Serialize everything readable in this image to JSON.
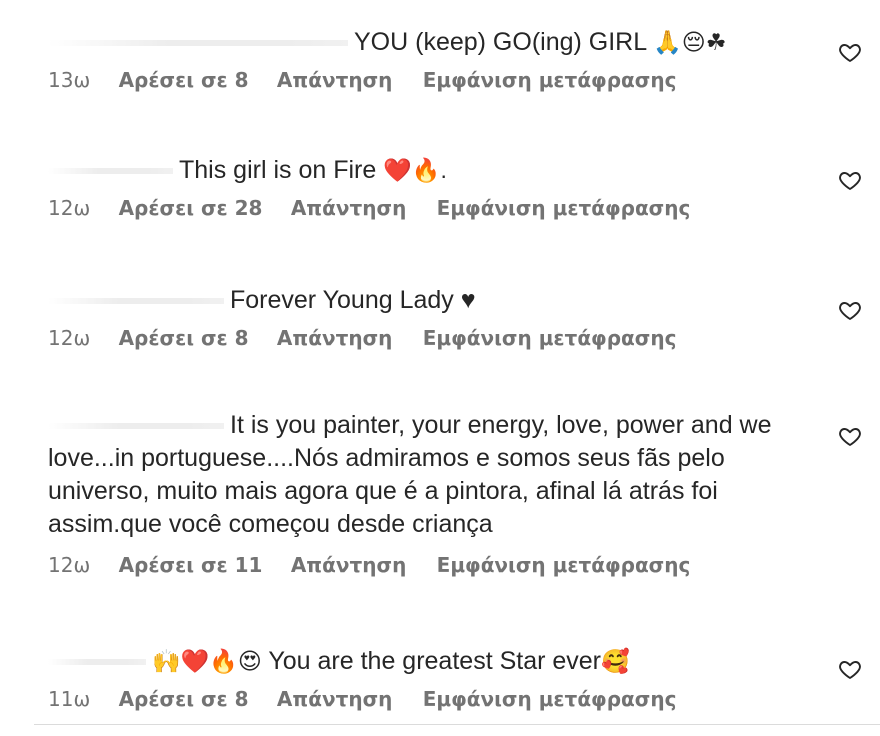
{
  "comments": [
    {
      "text": "YOU (keep) GO(ing) GIRL",
      "emojis": "🙏😔☘",
      "time": "13ω",
      "likes": "Αρέσει σε 8",
      "reply": "Απάντηση",
      "translate": "Εμφάνιση μετάφρασης"
    },
    {
      "text": "This girl is on Fire",
      "emojis": "❤️🔥.",
      "time": "12ω",
      "likes": "Αρέσει σε 28",
      "reply": "Απάντηση",
      "translate": "Εμφάνιση μετάφρασης"
    },
    {
      "text": "Forever Young Lady ♥",
      "emojis": "",
      "time": "12ω",
      "likes": "Αρέσει σε 8",
      "reply": "Απάντηση",
      "translate": "Εμφάνιση μετάφρασης"
    },
    {
      "text": "It is you painter, your energy, love, power and we love...in portuguese....Nós admiramos e somos seus fãs pelo universo, muito mais agora que é a pintora, afinal lá atrás foi assim.que você começou desde criança",
      "emojis": "",
      "time": "12ω",
      "likes": "Αρέσει σε 11",
      "reply": "Απάντηση",
      "translate": "Εμφάνιση μετάφρασης"
    },
    {
      "lead_emojis": "🙌❤️🔥😍",
      "text": "You are the greatest Star ever",
      "emojis": "🥰",
      "time": "11ω",
      "likes": "Αρέσει σε 8",
      "reply": "Απάντηση",
      "translate": "Εμφάνιση μετάφρασης"
    }
  ],
  "icons": {
    "like": "heart-outline-icon"
  },
  "colors": {
    "text": "#262626",
    "meta": "#737373",
    "divider": "#dbdbdb"
  }
}
